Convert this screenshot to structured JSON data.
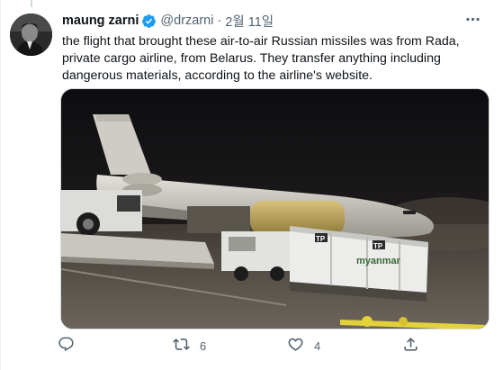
{
  "author": {
    "name": "maung zarni",
    "handle": "@drzarni",
    "separator": "·",
    "date": "2월 11일",
    "verified": true
  },
  "tweet": {
    "text": "the flight that brought these air-to-air Russian missiles was from Rada,\nprivate cargo airline, from Belarus.  They transfer anything including\ndangerous materials, according to the airline's website."
  },
  "media": {
    "container_logo_1": "TP",
    "container_brand": "myanmar",
    "container_logo_2": "TP"
  },
  "actions": {
    "reply_count": "",
    "retweet_count": "6",
    "like_count": "4",
    "share_count": ""
  },
  "colors": {
    "verified": "#1d9bf0",
    "secondary_text": "#536471",
    "primary_text": "#0f1419"
  },
  "icons": [
    "verified-badge-icon",
    "more-icon",
    "reply-icon",
    "retweet-icon",
    "like-icon",
    "share-icon"
  ]
}
